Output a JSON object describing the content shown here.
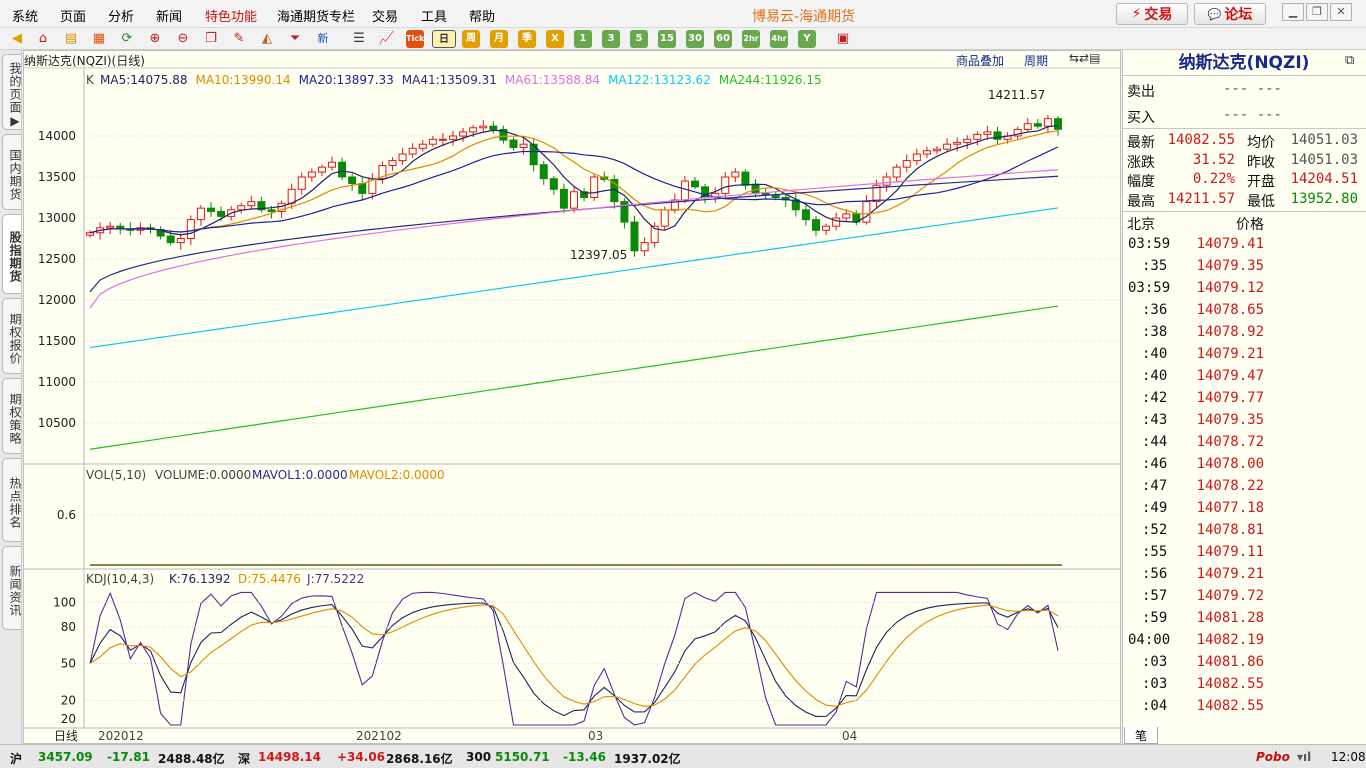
{
  "menu": [
    "系统",
    "页面",
    "分析",
    "新闻",
    "特色功能",
    "海通期货专栏",
    "交易",
    "工具",
    "帮助"
  ],
  "app_title": "博易云-海通期货",
  "trade_button": "交易",
  "forum_button": "论坛",
  "toolbar": {
    "periods": [
      "日",
      "周",
      "月",
      "季",
      "X",
      "1",
      "3",
      "5",
      "15",
      "30",
      "60",
      "2hr",
      "4hr",
      "Y"
    ],
    "tick_label": "Tick",
    "new_label": "新"
  },
  "side_tabs": [
    "我的页面",
    "国内期货",
    "股指期货",
    "期权报价",
    "期权策略",
    "热点排名",
    "新闻资讯"
  ],
  "chart": {
    "header": "纳斯达克(NQZI)(日线)",
    "overlay_link": "商品叠加",
    "period_link": "周期",
    "ma_prefix": "K",
    "ma_items": [
      {
        "label": "MA5:14075.88",
        "color": "#222266"
      },
      {
        "label": "MA10:13990.14",
        "color": "#e08a00"
      },
      {
        "label": "MA20:13897.33",
        "color": "#2020a0"
      },
      {
        "label": "MA41:13509.31",
        "color": "#2a2a8c"
      },
      {
        "label": "MA61:13588.84",
        "color": "#e070e0"
      },
      {
        "label": "MA122:13123.62",
        "color": "#10c8e8"
      },
      {
        "label": "MA244:11926.15",
        "color": "#22c022"
      }
    ],
    "price_ticks": [
      "14000",
      "13500",
      "13000",
      "12500",
      "12000",
      "11500",
      "11000",
      "10500"
    ],
    "high_label": "14211.57",
    "low_label": "12397.05",
    "vol_header": [
      {
        "label": "VOL(5,10)",
        "color": "#444"
      },
      {
        "label": "VOLUME:0.0000",
        "color": "#444"
      },
      {
        "label": "MAVOL1:0.0000",
        "color": "#2a2a8c"
      },
      {
        "label": "MAVOL2:0.0000",
        "color": "#e08a00"
      }
    ],
    "vol_tick": "0.6",
    "kdj_header": [
      {
        "label": "KDJ(10,4,3)",
        "color": "#444"
      },
      {
        "label": "K:76.1392",
        "color": "#222266"
      },
      {
        "label": "D:75.4476",
        "color": "#e08a00"
      },
      {
        "label": "J:77.5222",
        "color": "#5a2a9a"
      }
    ],
    "kdj_ticks": [
      "100",
      "80",
      "50",
      "20",
      "20"
    ],
    "date_labels": [
      "日线",
      "202012",
      "202102",
      "03",
      "04"
    ]
  },
  "quote": {
    "title": "纳斯达克(NQZI)",
    "sell_label": "卖出",
    "sell_value": "--- ---",
    "buy_label": "买入",
    "buy_value": "--- ---",
    "rows": [
      {
        "l1": "最新",
        "v1": "14082.55",
        "c1": "red",
        "l2": "均价",
        "v2": "14051.03",
        "c2": "gry"
      },
      {
        "l1": "涨跌",
        "v1": "31.52",
        "c1": "red",
        "l2": "昨收",
        "v2": "14051.03",
        "c2": "gry"
      },
      {
        "l1": "幅度",
        "v1": "0.22%",
        "c1": "red",
        "l2": "开盘",
        "v2": "14204.51",
        "c2": "red"
      },
      {
        "l1": "最高",
        "v1": "14211.57",
        "c1": "red",
        "l2": "最低",
        "v2": "13952.80",
        "c2": "grn"
      }
    ],
    "ticks_header_time": "北京",
    "ticks_header_price": "价格",
    "ticks": [
      [
        "03:59",
        "14079.41"
      ],
      [
        ":35",
        "14079.35"
      ],
      [
        "03:59",
        "14079.12"
      ],
      [
        ":36",
        "14078.65"
      ],
      [
        ":38",
        "14078.92"
      ],
      [
        ":40",
        "14079.21"
      ],
      [
        ":40",
        "14079.47"
      ],
      [
        ":42",
        "14079.77"
      ],
      [
        ":43",
        "14079.35"
      ],
      [
        ":44",
        "14078.72"
      ],
      [
        ":46",
        "14078.00"
      ],
      [
        ":47",
        "14078.22"
      ],
      [
        ":49",
        "14077.18"
      ],
      [
        ":52",
        "14078.81"
      ],
      [
        ":55",
        "14079.11"
      ],
      [
        ":56",
        "14079.21"
      ],
      [
        ":57",
        "14079.72"
      ],
      [
        ":59",
        "14081.28"
      ],
      [
        "04:00",
        "14082.19"
      ],
      [
        ":03",
        "14081.86"
      ],
      [
        ":03",
        "14082.55"
      ],
      [
        ":04",
        "14082.55"
      ]
    ],
    "bottom_tab": "笔"
  },
  "status": [
    {
      "label": "沪",
      "color": "#111"
    },
    {
      "label": "3457.09",
      "color": "#0a8a0a"
    },
    {
      "label": "-17.81",
      "color": "#0a8a0a"
    },
    {
      "label": "2488.48亿",
      "color": "#111"
    },
    {
      "label": "深",
      "color": "#111"
    },
    {
      "label": "14498.14",
      "color": "#d01818"
    },
    {
      "label": "+34.06",
      "color": "#d01818"
    },
    {
      "label": "2868.16亿",
      "color": "#111"
    },
    {
      "label": "300",
      "color": "#111"
    },
    {
      "label": "5150.71",
      "color": "#0a8a0a"
    },
    {
      "label": "-13.46",
      "color": "#0a8a0a"
    },
    {
      "label": "1937.02亿",
      "color": "#111"
    }
  ],
  "status_brand": "Pobo",
  "status_time": "12:08",
  "colors": {
    "up": "#e01818",
    "down": "#0a8a0a",
    "accent": "#d01010"
  }
}
